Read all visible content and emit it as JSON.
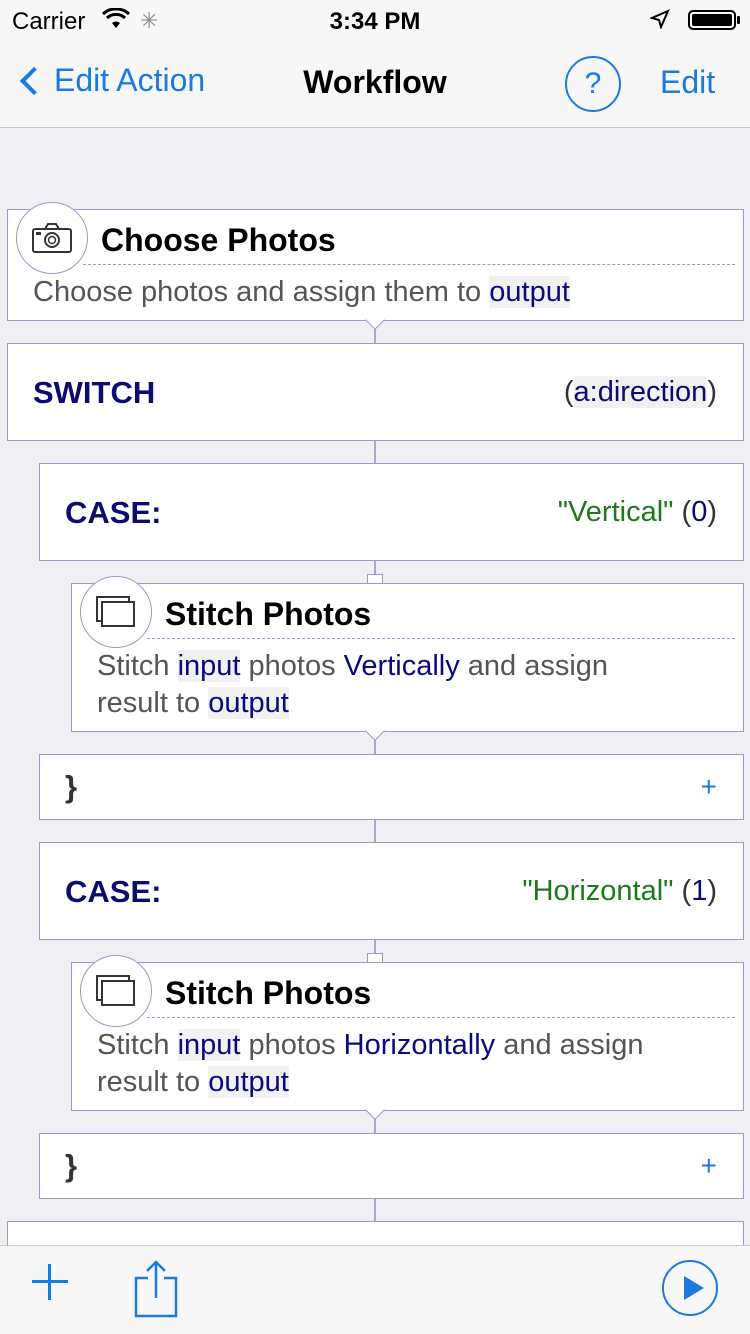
{
  "status_bar": {
    "carrier": "Carrier",
    "time": "3:34 PM"
  },
  "nav": {
    "back_label": "Edit Action",
    "title": "Workflow",
    "help_label": "?",
    "edit_label": "Edit"
  },
  "colors": {
    "accent": "#1a7ae0",
    "keyword": "#0b0b70",
    "string": "#1c7a1c",
    "border": "#9a99c8"
  },
  "choose_photos": {
    "title": "Choose Photos",
    "icon": "camera-icon",
    "desc_prefix": "Choose photos and assign them to ",
    "desc_token": "output"
  },
  "switch": {
    "keyword": "SWITCH",
    "open_paren": "(",
    "arg": "a:direction",
    "close_paren": ")"
  },
  "cases": [
    {
      "keyword": "CASE:",
      "string_value": "\"Vertical\"",
      "index_open": " (",
      "index": "0",
      "index_close": ")",
      "action": {
        "title": "Stitch Photos",
        "icon": "stack-icon",
        "desc_1": "Stitch ",
        "token_input": "input",
        "desc_2": " photos ",
        "token_direction": "Vertically",
        "desc_3": " and assign",
        "desc_4": "result to ",
        "token_output": "output"
      },
      "close_brace": "}",
      "add_label": "+"
    },
    {
      "keyword": "CASE:",
      "string_value": "\"Horizontal\"",
      "index_open": " (",
      "index": "1",
      "index_close": ")",
      "action": {
        "title": "Stitch Photos",
        "icon": "stack-icon",
        "desc_1": "Stitch ",
        "token_input": "input",
        "desc_2": " photos ",
        "token_direction": "Horizontally",
        "desc_3": " and assign",
        "desc_4": "result to ",
        "token_output": "output"
      },
      "close_brace": "}",
      "add_label": "+"
    }
  ],
  "toolbar": {
    "add_icon": "plus-icon",
    "share_icon": "share-icon",
    "run_icon": "play-icon"
  }
}
